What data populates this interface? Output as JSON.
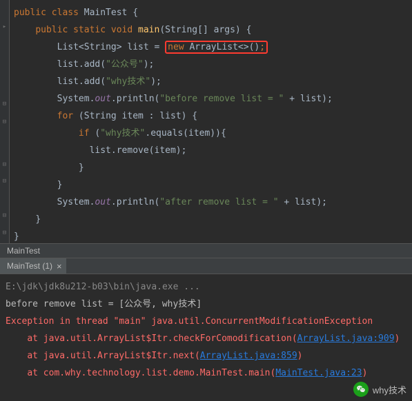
{
  "code": {
    "class_kw": "public class",
    "class_name": "MainTest",
    "open_brace": "{",
    "method_kw": "public static void",
    "method_name": "main",
    "method_params": "(String[] args)",
    "list_decl_left": "List<String> list = ",
    "list_new": "new",
    "list_ctor": " ArrayList<>()",
    "list_semicolon": ";",
    "add1_pre": "list.add(",
    "add1_str": "\"公众号\"",
    "add1_post": ");",
    "add2_pre": "list.add(",
    "add2_str": "\"why技术\"",
    "add2_post": ");",
    "print1_pre": "System.",
    "print1_out": "out",
    "print1_mid": ".println(",
    "print1_str": "\"before remove list = \"",
    "print1_post": " + list);",
    "for_kw": "for",
    "for_cond": " (String item : list) {",
    "if_kw": "if",
    "if_open": " (",
    "if_str": "\"why技术\"",
    "if_cond": ".equals(item)){",
    "remove": "list.remove(item);",
    "close_brace": "}",
    "print2_pre": "System.",
    "print2_out": "out",
    "print2_mid": ".println(",
    "print2_str": "\"after remove list = \"",
    "print2_post": " + list);"
  },
  "breadcrumb": {
    "text": "MainTest"
  },
  "tab": {
    "label": "MainTest (1)",
    "close": "×"
  },
  "console": {
    "cmd": "E:\\jdk\\jdk8u212-b03\\bin\\java.exe ...",
    "line_before": "before remove list = [公众号, why技术]",
    "exc_line_pre": "Exception in thread \"main\" java.util.ConcurrentModificationException",
    "frame1_pre": "    at java.util.ArrayList$Itr.checkForComodification(",
    "frame1_link": "ArrayList.java:909",
    "frame1_post": ")",
    "frame2_pre": "    at java.util.ArrayList$Itr.next(",
    "frame2_link": "ArrayList.java:859",
    "frame2_post": ")",
    "frame3_pre": "    at com.why.technology.list.demo.MainTest.main(",
    "frame3_link": "MainTest.java:23",
    "frame3_post": ")"
  },
  "watermark": {
    "text": "why技术"
  }
}
